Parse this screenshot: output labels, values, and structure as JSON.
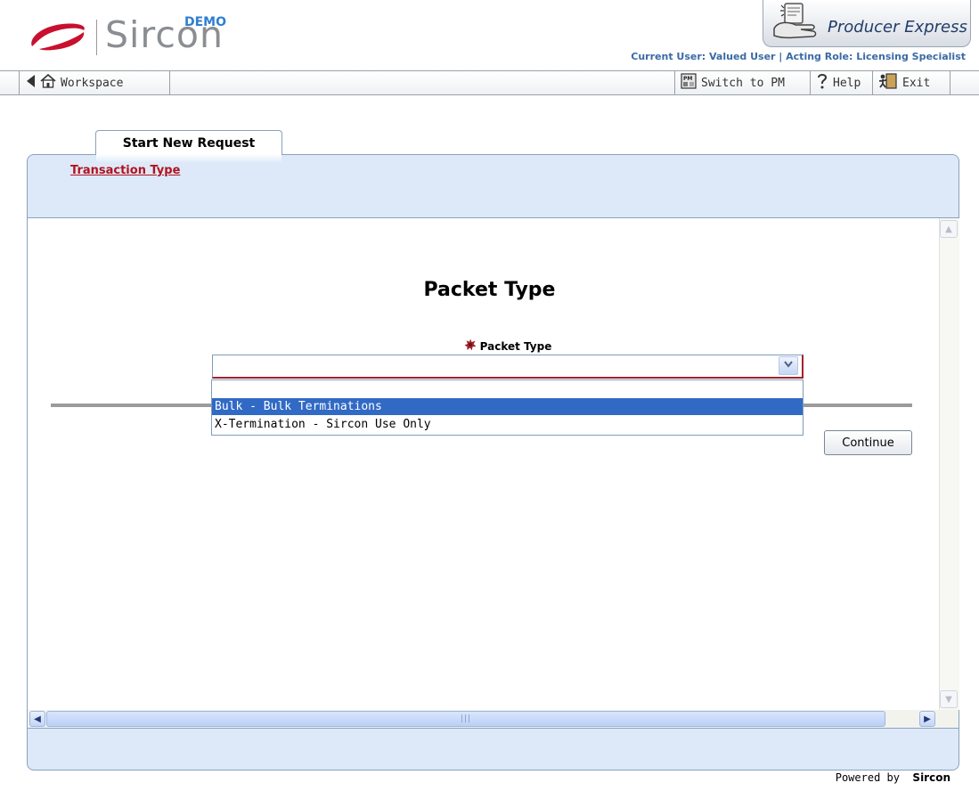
{
  "header": {
    "logo_text": "Sircon",
    "logo_badge": "DEMO",
    "product_name": "Producer Express",
    "user_info": "Current User: Valued User | Acting Role: Licensing Specialist"
  },
  "toolbar": {
    "workspace_label": "Workspace",
    "switch_label": "Switch to PM",
    "help_label": "Help",
    "exit_label": "Exit"
  },
  "tabs": [
    {
      "label": "Start New Request",
      "active": true
    }
  ],
  "breadcrumb": {
    "transaction_type": "Transaction Type"
  },
  "main": {
    "heading": "Packet Type",
    "field_label": "Packet Type",
    "field_required": true,
    "select_value": "",
    "options": [
      {
        "label": "",
        "highlighted": false
      },
      {
        "label": "Bulk - Bulk Terminations",
        "highlighted": true
      },
      {
        "label": "X-Termination - Sircon Use Only",
        "highlighted": false
      }
    ],
    "continue_label": "Continue"
  },
  "footer": {
    "powered_prefix": "Powered by",
    "powered_brand": "Sircon"
  },
  "icons": {
    "logo": "sircon-swoosh-icon",
    "product": "hand-document-icon",
    "back": "back-arrow-icon",
    "home": "home-icon",
    "switch": "pm-icon",
    "help": "question-mark-icon",
    "exit": "exit-door-icon",
    "required": "required-marker-icon",
    "dropdown": "chevron-down-icon"
  },
  "colors": {
    "brand_red": "#c8102e",
    "panel_blue": "#dde9f8",
    "link_red": "#b3121f",
    "selection_blue": "#316ac5",
    "user_info_blue": "#3a6aa5"
  }
}
